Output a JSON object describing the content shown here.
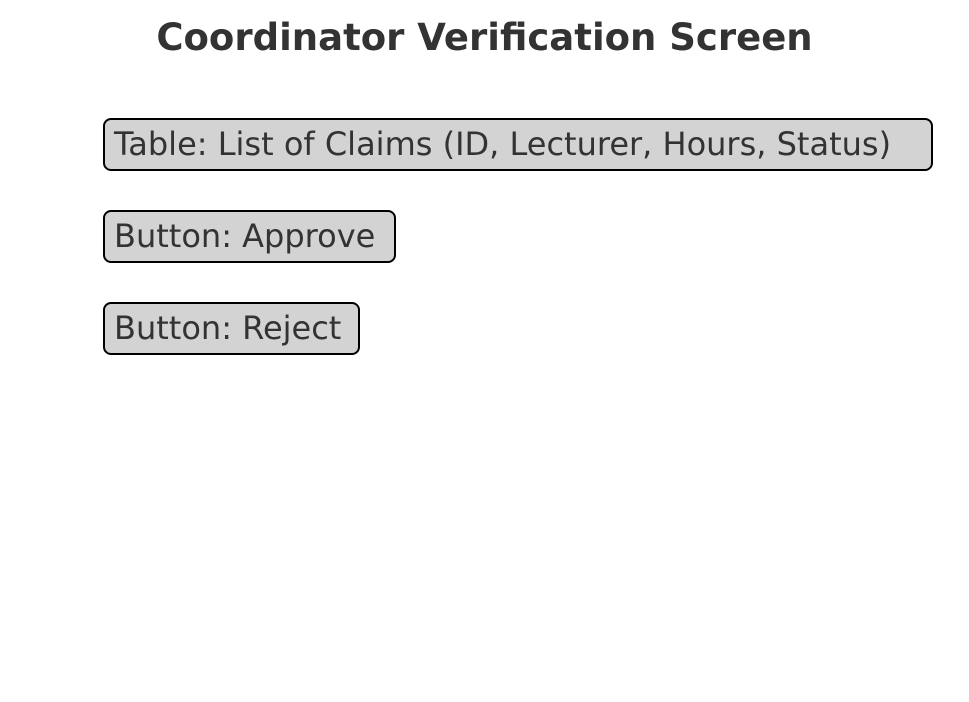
{
  "title": "Coordinator Verification Screen",
  "elements": [
    {
      "label": "Table: List of Claims (ID, Lecturer, Hours, Status)"
    },
    {
      "label": "Button: Approve"
    },
    {
      "label": "Button: Reject"
    }
  ],
  "colors": {
    "box_fill": "#d3d3d3",
    "box_border": "#000000",
    "text": "#333333",
    "background": "#ffffff"
  }
}
